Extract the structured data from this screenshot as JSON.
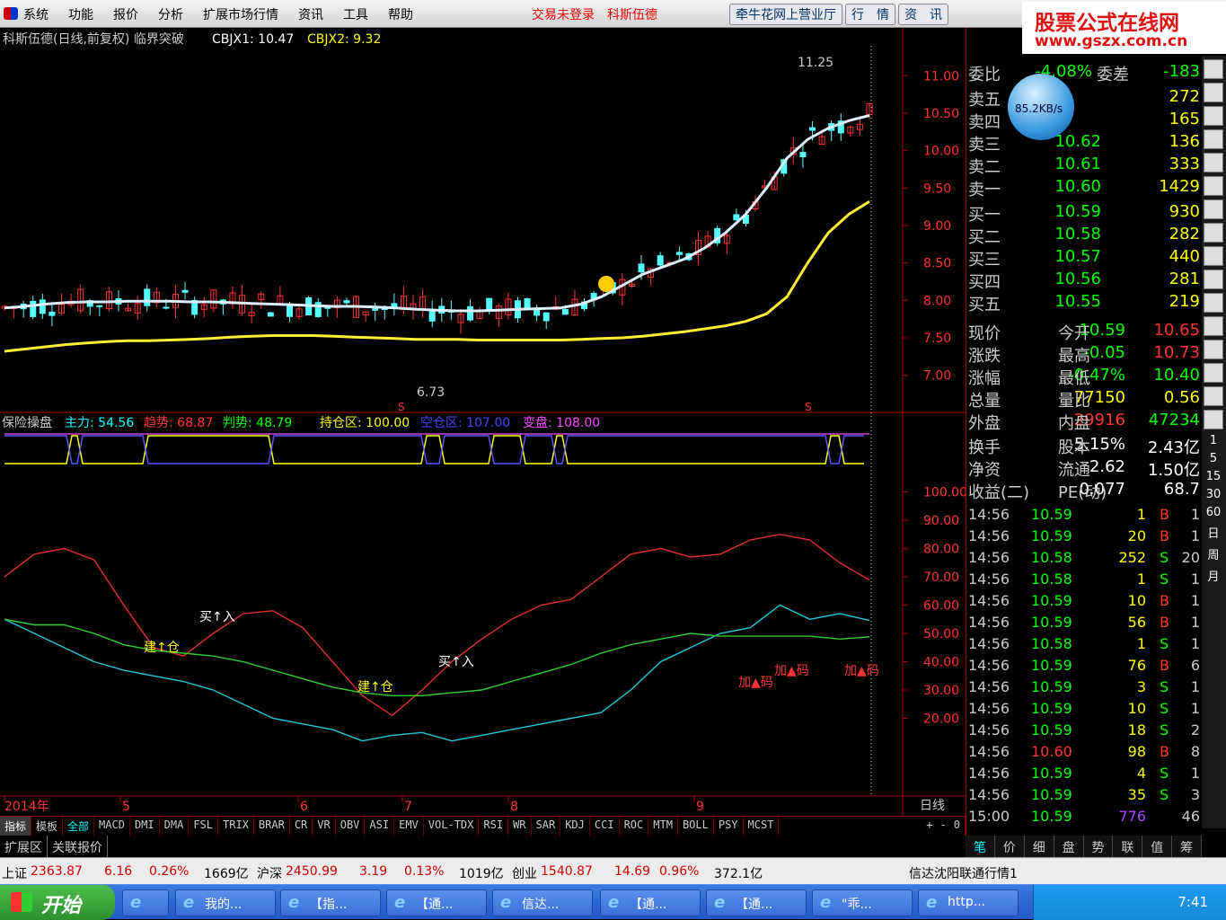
{
  "menubar": {
    "items": [
      "系统",
      "功能",
      "报价",
      "分析",
      "扩展市场行情",
      "资讯",
      "工具",
      "帮助"
    ],
    "status": [
      "交易未登录",
      "科斯伍德"
    ],
    "tabs": [
      "牵牛花网上营业厅",
      "行　情",
      "资　讯"
    ]
  },
  "brand": {
    "line1": "股票公式在线网",
    "line2": "www.gszx.com.cn"
  },
  "netspeed": "85.2KB/s",
  "main_chart": {
    "header": "科斯伍德(日线,前复权) 临界突破",
    "cbjx1_label": "CBJX1: 10.47",
    "cbjx2_label": "CBJX2: 9.32",
    "high_label": "11.25",
    "low_label": "6.73",
    "s_markers": [
      "S",
      "S"
    ]
  },
  "indicator": {
    "header_name": "保险操盘",
    "zhuli": "主力: 54.56",
    "qushi": "趋势: 68.87",
    "panshi": "判势: 48.79",
    "chicang": "持仓区: 100.00",
    "kongcang": "空仓区: 107.00",
    "bianpan": "变盘: 108.00",
    "annotations": [
      "建↑仓",
      "买↑入",
      "建↑仓",
      "买↑入",
      "加▲码",
      "加▲码",
      "加▲码"
    ]
  },
  "xaxis": {
    "labels": [
      "2014年",
      "5",
      "6",
      "7",
      "8",
      "9"
    ],
    "right": "日线"
  },
  "chart_data": [
    {
      "type": "candlestick",
      "title": "科斯伍德(日线,前复权) 临界突破",
      "ylim": [
        6.6,
        11.4
      ],
      "yticks": [
        "11.00",
        "10.50",
        "10.00",
        "9.50",
        "9.00",
        "8.50",
        "8.00",
        "7.50",
        "7.00"
      ],
      "series": [
        {
          "name": "CBJX1",
          "values": [
            7.9,
            7.92,
            7.95,
            7.97,
            7.98,
            7.98,
            7.99,
            7.99,
            7.99,
            7.98,
            7.98,
            7.97,
            7.96,
            7.95,
            7.94,
            7.93,
            7.92,
            7.92,
            7.91,
            7.9,
            7.88,
            7.87,
            7.86,
            7.86,
            7.87,
            7.88,
            7.89,
            7.9,
            7.95,
            8.05,
            8.2,
            8.35,
            8.45,
            8.55,
            8.7,
            8.9,
            9.15,
            9.5,
            9.9,
            10.15,
            10.3,
            10.4,
            10.47
          ]
        },
        {
          "name": "CBJX2",
          "values": [
            7.32,
            7.35,
            7.38,
            7.41,
            7.43,
            7.45,
            7.46,
            7.46,
            7.47,
            7.48,
            7.49,
            7.51,
            7.52,
            7.53,
            7.53,
            7.53,
            7.52,
            7.51,
            7.5,
            7.49,
            7.48,
            7.48,
            7.48,
            7.47,
            7.47,
            7.47,
            7.47,
            7.47,
            7.48,
            7.49,
            7.5,
            7.52,
            7.55,
            7.58,
            7.62,
            7.66,
            7.72,
            7.82,
            8.05,
            8.5,
            8.9,
            9.15,
            9.32
          ]
        }
      ]
    },
    {
      "type": "line",
      "title": "保险操盘",
      "ylim": [
        10,
        110
      ],
      "yticks": [
        "100.00",
        "90.00",
        "80.00",
        "70.00",
        "60.00",
        "50.00",
        "40.00",
        "30.00",
        "20.00"
      ],
      "series": [
        {
          "name": "主力",
          "values": [
            55,
            50,
            45,
            40,
            37,
            35,
            33,
            30,
            25,
            20,
            18,
            16,
            12,
            14,
            15,
            12,
            14,
            16,
            18,
            20,
            22,
            30,
            40,
            45,
            50,
            52,
            60,
            55,
            57,
            54.56
          ]
        },
        {
          "name": "趋势",
          "values": [
            70,
            78,
            80,
            76,
            60,
            45,
            42,
            50,
            57,
            58,
            52,
            40,
            28,
            21,
            30,
            40,
            48,
            55,
            60,
            62,
            70,
            78,
            80,
            77,
            78,
            83,
            85,
            83,
            75,
            68.87
          ]
        },
        {
          "name": "判势",
          "values": [
            55,
            53,
            53,
            50,
            46,
            44,
            43,
            42,
            40,
            37,
            34,
            31,
            29,
            28,
            28,
            29,
            30,
            33,
            36,
            39,
            43,
            46,
            48,
            50,
            49,
            49,
            49,
            49,
            48,
            48.79
          ]
        }
      ]
    }
  ],
  "quote": {
    "weibi_label": "委比",
    "weibi_val": "-4.08%",
    "weicha_label": "委差",
    "weicha_val": "-183",
    "sell": [
      [
        "卖五",
        "",
        "272"
      ],
      [
        "卖四",
        "",
        "165"
      ],
      [
        "卖三",
        "10.62",
        "136"
      ],
      [
        "卖二",
        "10.61",
        "333"
      ],
      [
        "卖一",
        "10.60",
        "1429"
      ]
    ],
    "buy": [
      [
        "买一",
        "10.59",
        "930"
      ],
      [
        "买二",
        "10.58",
        "282"
      ],
      [
        "买三",
        "10.57",
        "440"
      ],
      [
        "买四",
        "10.56",
        "281"
      ],
      [
        "买五",
        "10.55",
        "219"
      ]
    ],
    "stats": [
      [
        "现价",
        "10.59",
        "今开",
        "10.65"
      ],
      [
        "涨跌",
        "-0.05",
        "最高",
        "10.73"
      ],
      [
        "涨幅",
        "-0.47%",
        "最低",
        "10.40"
      ],
      [
        "总量",
        "77150",
        "量比",
        "0.56"
      ],
      [
        "外盘",
        "29916",
        "内盘",
        "47234"
      ],
      [
        "换手",
        "5.15%",
        "股本",
        "2.43亿"
      ],
      [
        "净资",
        "2.62",
        "流通",
        "1.50亿"
      ],
      [
        "收益(二)",
        "0.077",
        "PE(动)",
        "68.7"
      ]
    ],
    "trades": [
      [
        "14:56",
        "10.59",
        "1",
        "B",
        "1"
      ],
      [
        "14:56",
        "10.59",
        "20",
        "B",
        "1"
      ],
      [
        "14:56",
        "10.58",
        "252",
        "S",
        "20"
      ],
      [
        "14:56",
        "10.58",
        "1",
        "S",
        "1"
      ],
      [
        "14:56",
        "10.59",
        "10",
        "B",
        "1"
      ],
      [
        "14:56",
        "10.59",
        "56",
        "B",
        "1"
      ],
      [
        "14:56",
        "10.58",
        "1",
        "S",
        "1"
      ],
      [
        "14:56",
        "10.59",
        "76",
        "B",
        "6"
      ],
      [
        "14:56",
        "10.59",
        "3",
        "S",
        "1"
      ],
      [
        "14:56",
        "10.59",
        "10",
        "S",
        "1"
      ],
      [
        "14:56",
        "10.59",
        "18",
        "S",
        "2"
      ],
      [
        "14:56",
        "10.60",
        "98",
        "B",
        "8"
      ],
      [
        "14:56",
        "10.59",
        "4",
        "S",
        "1"
      ],
      [
        "14:56",
        "10.59",
        "35",
        "S",
        "3"
      ],
      [
        "15:00",
        "10.59",
        "776",
        "",
        "46"
      ]
    ]
  },
  "side": {
    "nums": [
      "1",
      "5",
      "15",
      "30",
      "60",
      "日",
      "周",
      "月"
    ]
  },
  "indicator_tabs": [
    "指标",
    "模板",
    "全部",
    "MACD",
    "DMI",
    "DMA",
    "FSL",
    "TRIX",
    "BRAR",
    "CR",
    "VR",
    "OBV",
    "ASI",
    "EMV",
    "VOL-TDX",
    "RSI",
    "WR",
    "SAR",
    "KDJ",
    "CCI",
    "ROC",
    "MTM",
    "BOLL",
    "PSY",
    "MCST"
  ],
  "zoom": [
    "+",
    "-",
    "0"
  ],
  "ext_tabs": [
    "扩展区",
    "关联报价"
  ],
  "quote_tabs": [
    "笔",
    "价",
    "细",
    "盘",
    "势",
    "联",
    "值",
    "筹"
  ],
  "index_bar": [
    {
      "name": "上证",
      "val": "2363.87",
      "chg": "6.16",
      "pct": "0.26%",
      "amt": "1669亿"
    },
    {
      "name": "沪深",
      "val": "2450.99",
      "chg": "3.19",
      "pct": "0.13%",
      "amt": "1019亿"
    },
    {
      "name": "创业",
      "val": "1540.87",
      "chg": "14.69",
      "pct": "0.96%",
      "amt": "372.1亿"
    }
  ],
  "index_status": "信达沈阳联通行情1",
  "taskbar": {
    "start": "开始",
    "buttons": [
      "我的...",
      "【指...",
      "【通...",
      "信达...",
      "【通...",
      "【通...",
      "\"乖...",
      "http..."
    ],
    "clock": "7:41"
  }
}
